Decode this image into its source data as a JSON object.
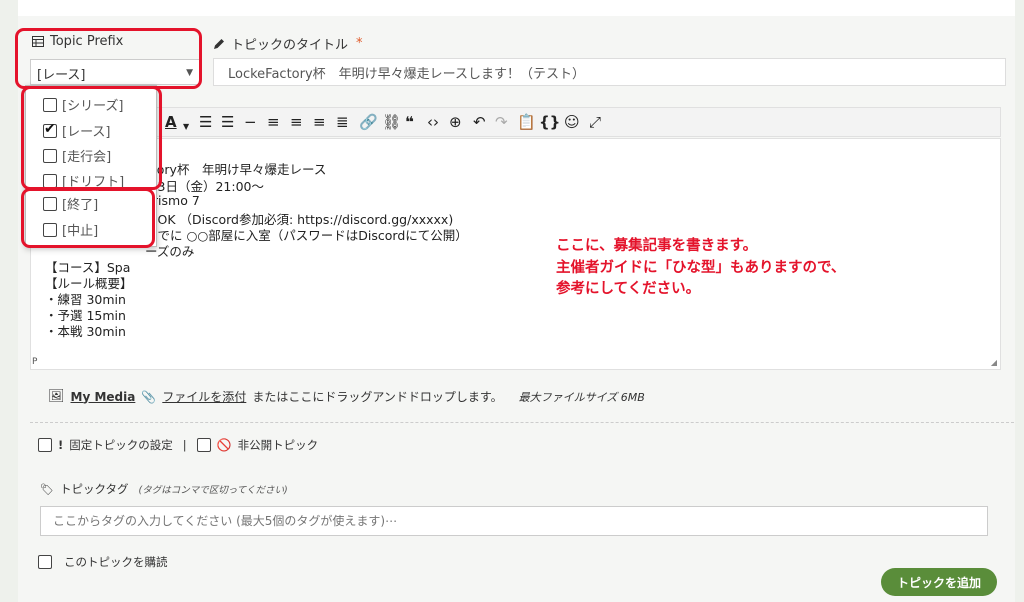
{
  "form": {
    "prefix_label": "Topic Prefix",
    "title_label": "トピックのタイトル",
    "required_mark": "*",
    "prefix_selected": "[レース]",
    "title_value": "LockeFactory杯　年明け早々爆走レースします！（テスト）"
  },
  "prefix_options": [
    {
      "label": "[シリーズ]",
      "checked": false
    },
    {
      "label": "[レース]",
      "checked": true
    },
    {
      "label": "[走行会]",
      "checked": false
    },
    {
      "label": "[ドリフト]",
      "checked": false
    },
    {
      "label": "[終了]",
      "checked": false
    },
    {
      "label": "[中止]",
      "checked": false
    }
  ],
  "toolbar_icons": [
    "font-color-icon",
    "dropdown-caret-icon",
    "bulleted-list-icon",
    "numbered-list-icon",
    "horizontal-rule-icon",
    "align-left-icon",
    "align-center-icon",
    "align-right-icon",
    "align-justify-icon",
    "link-icon",
    "unlink-icon",
    "quote-icon",
    "code-icon",
    "insert-icon",
    "undo-icon",
    "redo-icon",
    "paste-icon",
    "source-code-icon",
    "emoji-icon",
    "fullscreen-icon"
  ],
  "editor": {
    "lines": [
      "ctory杯　年明け早々爆走レース",
      "月3日（金）21:00〜",
      "urismo 7",
      "もOK （Discord参加必須: https://discord.gg/xxxxx)",
      "までに ○○部屋に入室（パスワードはDiscordにて公開）",
      "ーズのみ",
      "【コース】Spa",
      "【ルール概要】",
      "・練習 30min",
      "・予選 15min",
      "・本戦 30min"
    ],
    "footer": "P",
    "hint_lines": [
      "ここに、募集記事を書きます。",
      "主催者ガイドに「ひな型」もありますので、",
      "参考にしてください。"
    ]
  },
  "media": {
    "my_media": "My Media",
    "attach": "ファイルを添付",
    "drop_text": "またはここにドラッグアンドドロップします。",
    "max_size": "最大ファイルサイズ 6MB"
  },
  "options": {
    "sticky": "固定トピックの設定",
    "separator": "|",
    "private": "非公開トピック"
  },
  "tags": {
    "label": "トピックタグ",
    "sub": "(タグはコンマで区切ってください)",
    "placeholder": "ここからタグの入力してください (最大5個のタグが使えます)⋯"
  },
  "subscribe": "このトピックを購読",
  "submit": "トピックを追加",
  "colors": {
    "accent": "#5a8d3a",
    "annotation": "#e4132b"
  }
}
